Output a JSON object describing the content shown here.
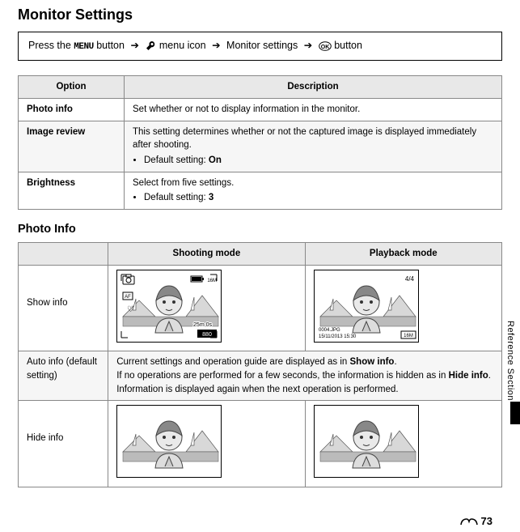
{
  "page_title": "Monitor Settings",
  "instruction": {
    "prefix": "Press the",
    "menu_word": "MENU",
    "after_menu": "button",
    "arrow": "➔",
    "wrench_icon": "wrench-icon",
    "text1": "menu icon",
    "text2": "Monitor settings",
    "ok_icon": "ok-icon",
    "text3": "button"
  },
  "table1": {
    "head_option": "Option",
    "head_desc": "Description",
    "rows": [
      {
        "option": "Photo info",
        "desc": "Set whether or not to display information in the monitor."
      },
      {
        "option": "Image review",
        "desc_line1": "This setting determines whether or not the captured image is displayed immediately after shooting.",
        "bullet_prefix": "Default setting:",
        "bullet_value": "On"
      },
      {
        "option": "Brightness",
        "desc_line1": "Select from five settings.",
        "bullet_prefix": "Default setting:",
        "bullet_value": "3"
      }
    ]
  },
  "subheading": "Photo Info",
  "table2": {
    "head_shoot": "Shooting mode",
    "head_play": "Playback mode",
    "rows": {
      "show_info": "Show info",
      "auto_info_label": "Auto info (default setting)",
      "auto_info_p1a": "Current settings and operation guide are displayed as in ",
      "auto_info_p1b": "Show info",
      "auto_info_p1c": ".",
      "auto_info_p2a": "If no operations are performed for a few seconds, the information is hidden as in ",
      "auto_info_p2b": "Hide info",
      "auto_info_p2c": ". Information is displayed again when the next operation is performed.",
      "hide_info": "Hide info"
    },
    "show_info_shoot_overlay": {
      "top_left_icon": "camera",
      "top_right": "16M",
      "battery": "full",
      "mid_left": "AF",
      "heart": "♡",
      "time": "25m 0s",
      "bottom": "880"
    },
    "show_info_play_overlay": {
      "top_right": "4/4",
      "filename": "0004.JPG",
      "date": "15/11/2013",
      "time": "15:30",
      "bottom_right": "16M"
    }
  },
  "side_tab_text": "Reference Section",
  "page_number": "73"
}
